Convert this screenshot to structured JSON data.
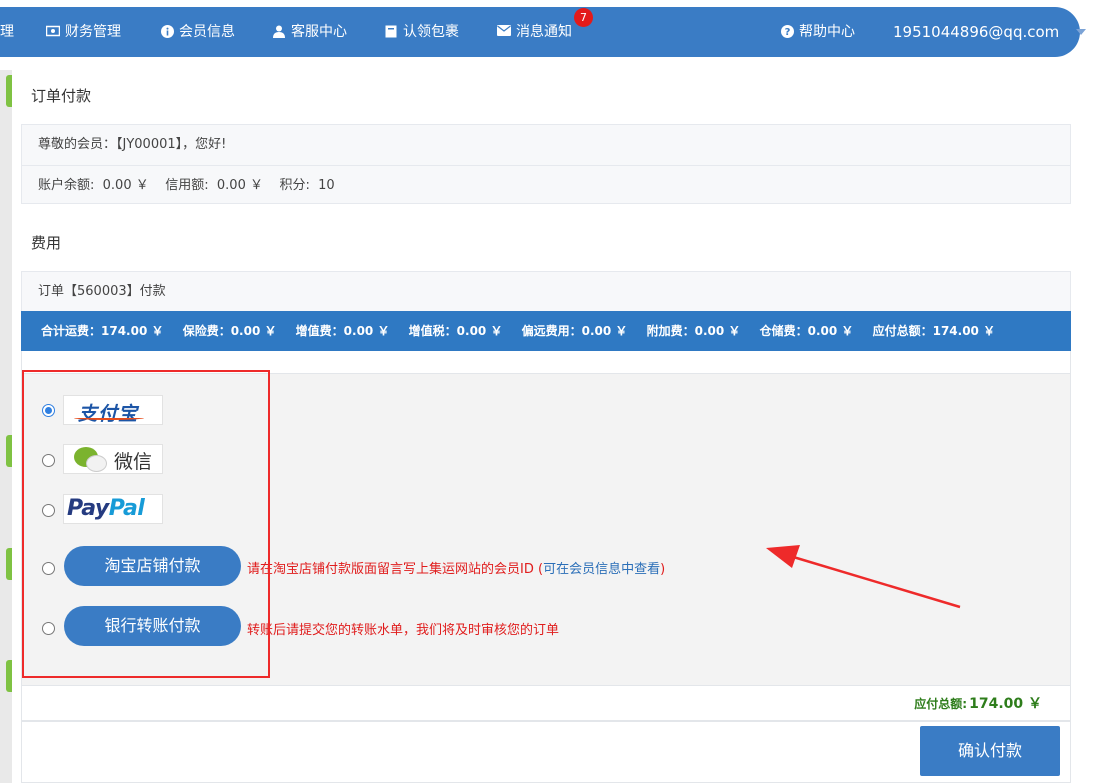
{
  "nav": {
    "cut_item": "理",
    "items": [
      {
        "label": "财务管理",
        "icon": "money-icon"
      },
      {
        "label": "会员信息",
        "icon": "info-icon"
      },
      {
        "label": "客服中心",
        "icon": "user-icon"
      },
      {
        "label": "认领包裹",
        "icon": "package-icon"
      },
      {
        "label": "消息通知",
        "icon": "envelope-icon",
        "badge": "7"
      }
    ],
    "help": "帮助中心",
    "user_email": "1951044896@qq.com"
  },
  "page": {
    "title": "订单付款",
    "greeting": "尊敬的会员：【JY00001】，您好!",
    "account_line": "账户余额:  0.00 ￥    信用额:  0.00 ￥    积分:  10",
    "fee_section_title": "费用",
    "order_line": "订单【560003】付款"
  },
  "fees": [
    "合计运费：174.00 ￥",
    "保险费：0.00 ￥",
    "增值费：0.00 ￥",
    "增值税：0.00 ￥",
    "偏远费用：0.00 ￥",
    "附加费：0.00 ￥",
    "仓储费：0.00 ￥",
    "应付总额：174.00 ￥"
  ],
  "payment": {
    "alipay_logo": "支付宝",
    "wechat_logo": "微信",
    "paypal_logo_pay": "Pay",
    "paypal_logo_pal": "Pal",
    "taobao_button": "淘宝店铺付款",
    "taobao_note": "请在淘宝店铺付款版面留言写上集运网站的会员ID (",
    "taobao_note_link": "可在会员信息中查看",
    "taobao_note_end": ")",
    "bank_button": "银行转账付款",
    "bank_note": "转账后请提交您的转账水单，我们将及时审核您的订单",
    "selected": "alipay"
  },
  "total": {
    "label": "应付总额:",
    "value": "174.00 ￥"
  },
  "confirm_button": "确认付款",
  "colors": {
    "nav_bg": "#3a7cc5",
    "fee_bar": "#2f79c3",
    "note_red": "#e01d1d",
    "total_green": "#2e7d1b",
    "annotation_red": "#ee2a2a"
  }
}
